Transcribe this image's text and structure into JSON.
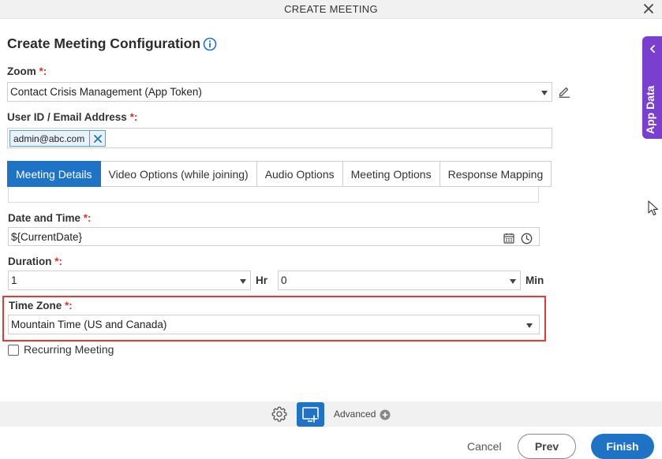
{
  "window": {
    "title": "CREATE MEETING"
  },
  "page": {
    "heading": "Create Meeting Configuration"
  },
  "zoom": {
    "label": "Zoom",
    "required": "*:",
    "value": "Contact Crisis Management (App Token)"
  },
  "user": {
    "label": "User ID / Email Address",
    "required": "*:",
    "chip": "admin@abc.com"
  },
  "tabs": [
    {
      "label": "Meeting Details",
      "active": true
    },
    {
      "label": "Video Options (while joining)",
      "active": false
    },
    {
      "label": "Audio Options",
      "active": false
    },
    {
      "label": "Meeting Options",
      "active": false
    },
    {
      "label": "Response Mapping",
      "active": false
    }
  ],
  "date_time": {
    "label": "Date and Time",
    "required": "*:",
    "value": "${CurrentDate}"
  },
  "duration": {
    "label": "Duration",
    "required": "*:",
    "hours_value": "1",
    "hours_unit": "Hr",
    "minutes_value": "0",
    "minutes_unit": "Min"
  },
  "time_zone": {
    "label": "Time Zone",
    "required": "*:",
    "value": "Mountain Time (US and Canada)"
  },
  "recurring": {
    "label": "Recurring Meeting",
    "checked": false
  },
  "side_panel": {
    "label": "App Data"
  },
  "toolbar": {
    "advanced_label": "Advanced"
  },
  "footer": {
    "cancel": "Cancel",
    "prev": "Prev",
    "finish": "Finish"
  },
  "colors": {
    "primary": "#1e73c7",
    "side_panel": "#7b3fd0",
    "highlight": "#e53935",
    "required": "#d9362e"
  }
}
